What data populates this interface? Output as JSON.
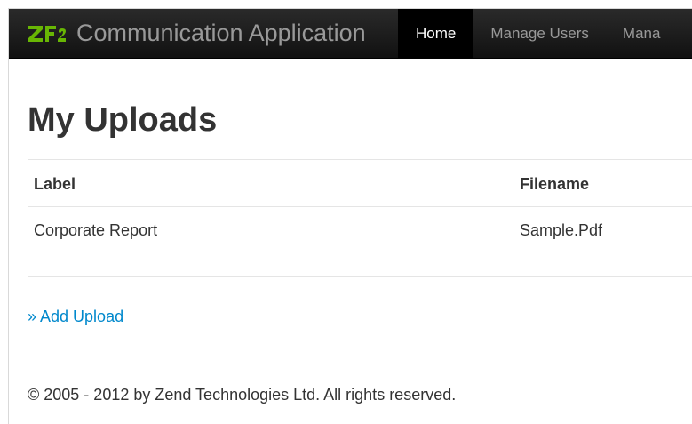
{
  "app": {
    "title": "Communication Application",
    "logo_text": "ZF2"
  },
  "nav": {
    "items": [
      {
        "label": "Home",
        "active": true
      },
      {
        "label": "Manage Users",
        "active": false
      },
      {
        "label": "Mana",
        "active": false
      }
    ]
  },
  "page": {
    "title": "My Uploads"
  },
  "table": {
    "headers": [
      "Label",
      "Filename"
    ],
    "rows": [
      [
        "Corporate Report",
        "Sample.Pdf"
      ]
    ]
  },
  "actions": {
    "add_upload": "» Add Upload"
  },
  "footer": {
    "text": "© 2005 - 2012 by Zend Technologies Ltd. All rights reserved."
  },
  "colors": {
    "navbar": "#1b1b1b",
    "nav_active": "#000000",
    "logo_green": "#68b604",
    "link": "#0088cc",
    "text": "#333333"
  },
  "icons": [
    "zf2-logo"
  ]
}
